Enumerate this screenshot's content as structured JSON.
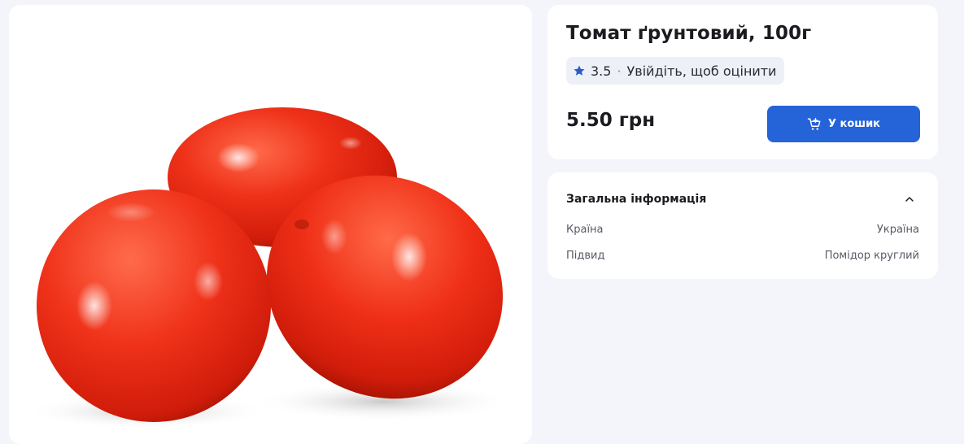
{
  "product": {
    "title": "Томат ґрунтовий, 100г",
    "image_subject": "three red tomatoes",
    "rating": {
      "icon": "star-icon",
      "value": "3.5",
      "separator": "·",
      "login_prompt": "Увійдіть, щоб оцінити"
    },
    "price": "5.50 грн",
    "cart_button": {
      "icon": "cart-add-icon",
      "label": "У кошик"
    }
  },
  "info": {
    "title": "Загальна інформація",
    "toggle_icon": "chevron-up-icon",
    "expanded": true,
    "rows": [
      {
        "label": "Країна",
        "value": "Україна"
      },
      {
        "label": "Підвид",
        "value": "Помідор круглий"
      }
    ]
  },
  "colors": {
    "accent": "#2563d8",
    "star": "#2b5bc9",
    "background": "#f4f5fb",
    "card": "#ffffff",
    "tomato": "#e82a14"
  }
}
